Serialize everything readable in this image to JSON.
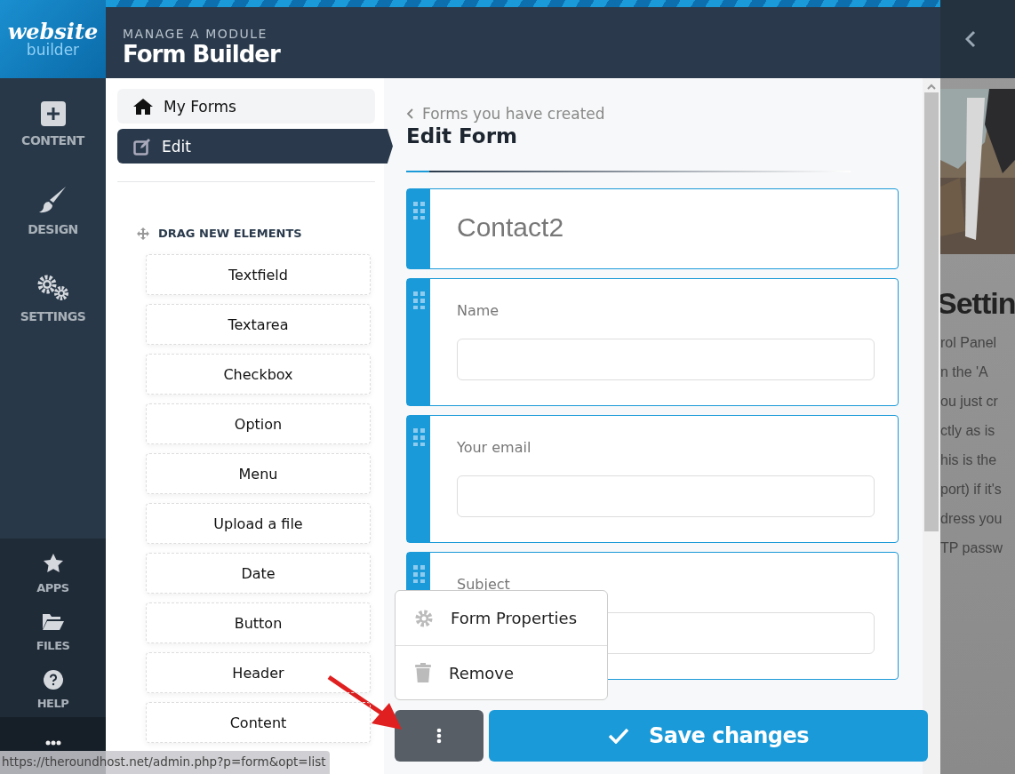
{
  "logo": {
    "script": "website",
    "sub": "builder"
  },
  "sidebar": {
    "items": [
      {
        "label": "CONTENT",
        "kind": "plus"
      },
      {
        "label": "DESIGN",
        "kind": "brush"
      },
      {
        "label": "SETTINGS",
        "kind": "gears"
      }
    ],
    "bottom_items": [
      {
        "label": "APPS",
        "kind": "star"
      },
      {
        "label": "FILES",
        "kind": "folder"
      },
      {
        "label": "HELP",
        "kind": "help"
      }
    ]
  },
  "header": {
    "subtitle": "MANAGE A MODULE",
    "title": "Form Builder"
  },
  "nav": [
    {
      "label": "My Forms",
      "kind": "home",
      "selected": false
    },
    {
      "label": "Edit",
      "kind": "edit",
      "selected": true
    }
  ],
  "elements": {
    "heading": "DRAG NEW ELEMENTS",
    "items": [
      "Textfield",
      "Textarea",
      "Checkbox",
      "Option",
      "Menu",
      "Upload a file",
      "Date",
      "Button",
      "Header",
      "Content"
    ]
  },
  "form": {
    "breadcrumb": "Forms you have created",
    "title": "Edit Form",
    "fields": [
      {
        "kind": "title",
        "value": "Contact2"
      },
      {
        "kind": "input",
        "label": "Name"
      },
      {
        "kind": "input",
        "label": "Your email"
      },
      {
        "kind": "input",
        "label": "Subject"
      }
    ]
  },
  "menu": [
    {
      "label": "Form Properties",
      "kind": "gear"
    },
    {
      "label": "Remove",
      "kind": "trash"
    }
  ],
  "save_button": "Save changes",
  "backdrop": {
    "heading": "Settin",
    "lines": [
      "rol Panel",
      "n the 'A",
      "ou just cr",
      "ctly as is",
      "his is the",
      "port) if it's",
      "dress you",
      "TP passw"
    ]
  },
  "status_url": "https://theroundhost.net/admin.php?p=form&opt=list"
}
